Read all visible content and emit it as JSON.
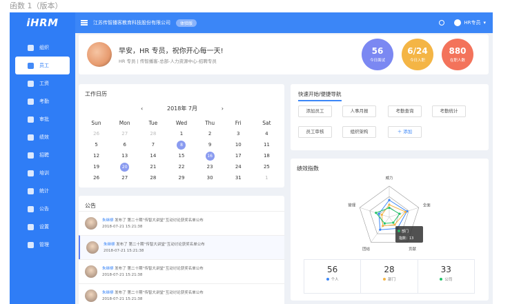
{
  "top_note": "函数 1（版本）",
  "app": {
    "logo": "iHRM",
    "sidebar": {
      "items": [
        {
          "label": "组织",
          "icon": "org-icon",
          "active": false
        },
        {
          "label": "员工",
          "icon": "user-icon",
          "active": true
        },
        {
          "label": "工资",
          "icon": "salary-icon",
          "active": false
        },
        {
          "label": "考勤",
          "icon": "attendance-icon",
          "active": false
        },
        {
          "label": "审批",
          "icon": "approval-icon",
          "active": false
        },
        {
          "label": "绩效",
          "icon": "performance-icon",
          "active": false
        },
        {
          "label": "招聘",
          "icon": "recruit-icon",
          "active": false
        },
        {
          "label": "培训",
          "icon": "training-icon",
          "active": false
        },
        {
          "label": "统计",
          "icon": "chart-icon",
          "active": false
        },
        {
          "label": "公告",
          "icon": "announcement-icon",
          "active": false
        },
        {
          "label": "设置",
          "icon": "settings-icon",
          "active": false
        },
        {
          "label": "管理",
          "icon": "manage-icon",
          "active": false
        }
      ]
    },
    "topbar": {
      "company": "江苏传智播客教育科技股份有限公司",
      "badge": "体验版",
      "user": "HR专员"
    }
  },
  "welcome": {
    "title": "早安，HR 专员，祝你开心每一天!",
    "subtitle": "HR 专员 | 传智播客-总部-人力资源中心-招聘专员",
    "stats": [
      {
        "value": "56",
        "label": "今日面试",
        "color": "#7b88f2"
      },
      {
        "value": "6/24",
        "label": "今日入职",
        "color": "#f4b545"
      },
      {
        "value": "880",
        "label": "在职人数",
        "color": "#f3735b"
      }
    ]
  },
  "calendar": {
    "title": "工作日历",
    "month": "2018年 7月",
    "weekdays": [
      "Sun",
      "Mon",
      "Tue",
      "Wed",
      "Thu",
      "Fri",
      "Sat"
    ],
    "days": [
      {
        "d": "26",
        "m": true
      },
      {
        "d": "27",
        "m": true
      },
      {
        "d": "28",
        "m": true
      },
      {
        "d": "1"
      },
      {
        "d": "2"
      },
      {
        "d": "3"
      },
      {
        "d": "4"
      },
      {
        "d": "5"
      },
      {
        "d": "6"
      },
      {
        "d": "7"
      },
      {
        "d": "8",
        "hl": true
      },
      {
        "d": "9"
      },
      {
        "d": "10"
      },
      {
        "d": "11"
      },
      {
        "d": "12"
      },
      {
        "d": "13"
      },
      {
        "d": "14"
      },
      {
        "d": "15"
      },
      {
        "d": "16",
        "hl": true
      },
      {
        "d": "17"
      },
      {
        "d": "18"
      },
      {
        "d": "19"
      },
      {
        "d": "20",
        "hl": true
      },
      {
        "d": "21"
      },
      {
        "d": "22"
      },
      {
        "d": "23"
      },
      {
        "d": "24"
      },
      {
        "d": "25"
      },
      {
        "d": "26"
      },
      {
        "d": "27"
      },
      {
        "d": "28"
      },
      {
        "d": "29"
      },
      {
        "d": "30"
      },
      {
        "d": "31"
      },
      {
        "d": "1",
        "m": true
      }
    ]
  },
  "notice": {
    "title": "公告",
    "items": [
      {
        "who": "朱继柳",
        "text": "发布了 第二十期“传智大讲堂”互动讨论获奖名单公布",
        "time": "2018-07-21 15:21:38"
      },
      {
        "who": "朱继柳",
        "text": "发布了 第二十期“传智大讲堂”互动讨论获奖名单公布",
        "time": "2018-07-21 15:21:38",
        "active": true
      },
      {
        "who": "朱继柳",
        "text": "发布了 第二十期“传智大讲堂”互动讨论获奖名单公布",
        "time": "2018-07-21 15:21:38"
      },
      {
        "who": "朱继柳",
        "text": "发布了 第二十期“传智大讲堂”互动讨论获奖名单公布",
        "time": "2018-07-21 15:21:38"
      }
    ]
  },
  "quick": {
    "title": "快速开始/便捷导航",
    "buttons": [
      "添加员工",
      "人事月报",
      "考勤查询",
      "考勤统计",
      "员工审核",
      "组织架构",
      "＋ 添加"
    ]
  },
  "performance": {
    "title": "绩效指数",
    "axes": [
      "威力",
      "全面",
      "贡献",
      "团结",
      "管理"
    ],
    "tooltip": {
      "name": "部门",
      "value_label": "指数：13"
    },
    "totals": [
      {
        "value": "56",
        "label": "个人",
        "color": "#3b86f7"
      },
      {
        "value": "28",
        "label": "部门",
        "color": "#f4b545"
      },
      {
        "value": "33",
        "label": "公司",
        "color": "#23c36a"
      }
    ]
  },
  "chart_data": {
    "type": "radar",
    "axes": [
      "威力",
      "全面",
      "贡献",
      "团结",
      "管理"
    ],
    "series": [
      {
        "name": "个人",
        "values": [
          0.55,
          0.6,
          0.45,
          0.5,
          0.35
        ],
        "color": "#3b86f7"
      },
      {
        "name": "部门",
        "values": [
          0.4,
          0.55,
          0.3,
          0.35,
          0.25
        ],
        "color": "#f4b545"
      },
      {
        "name": "公司",
        "values": [
          0.3,
          0.35,
          0.22,
          0.25,
          0.45
        ],
        "color": "#23c36a"
      }
    ],
    "max": 1
  }
}
